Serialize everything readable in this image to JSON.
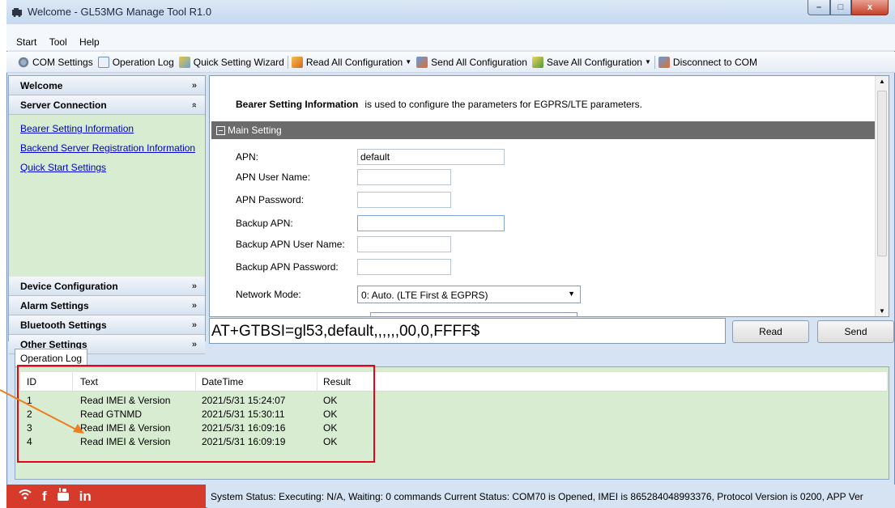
{
  "window": {
    "title": "Welcome - GL53MG Manage Tool R1.0",
    "controls": [
      "minimize",
      "maximize",
      "close"
    ]
  },
  "menu": [
    "Start",
    "Tool",
    "Help"
  ],
  "toolbar": {
    "com_settings": "COM Settings",
    "operation_log": "Operation Log",
    "quick_setting_wizard": "Quick Setting Wizard",
    "read_all": "Read All Configuration",
    "send_all": "Send All Configuration",
    "save_all": "Save All Configuration",
    "disconnect": "Disconnect to COM"
  },
  "nav": {
    "welcome": "Welcome",
    "server_connection": "Server Connection",
    "links": [
      "Bearer Setting Information",
      "Backend Server Registration Information",
      "Quick Start Settings"
    ],
    "device_configuration": "Device Configuration",
    "alarm_settings": "Alarm Settings",
    "bluetooth_settings": "Bluetooth Settings",
    "other_settings": "Other Settings"
  },
  "main": {
    "desc_title": "Bearer Setting Information",
    "desc_text": "is used to configure the parameters for EGPRS/LTE parameters.",
    "section": "Main Setting",
    "fields": {
      "apn_label": "APN:",
      "apn_value": "default",
      "apn_user_label": "APN User Name:",
      "apn_user_value": "",
      "apn_pass_label": "APN Password:",
      "apn_pass_value": "",
      "backup_apn_label": "Backup APN:",
      "backup_apn_value": "",
      "backup_user_label": "Backup APN User Name:",
      "backup_user_value": "",
      "backup_pass_label": "Backup APN Password:",
      "backup_pass_value": "",
      "network_mode_label": "Network Mode:",
      "network_mode_value": "0: Auto. (LTE First & EGPRS)"
    }
  },
  "command": {
    "text": "AT+GTBSI=gl53,default,,,,,,00,0,FFFF$",
    "read": "Read",
    "send": "Send"
  },
  "log": {
    "tab": "Operation Log",
    "headers": [
      "ID",
      "Text",
      "DateTime",
      "Result"
    ],
    "rows": [
      {
        "id": "1",
        "text": "Read IMEI & Version",
        "datetime": "2021/5/31 15:24:07",
        "result": "OK"
      },
      {
        "id": "2",
        "text": "Read GTNMD",
        "datetime": "2021/5/31 15:30:11",
        "result": "OK"
      },
      {
        "id": "3",
        "text": "Read IMEI & Version",
        "datetime": "2021/5/31 16:09:16",
        "result": "OK"
      },
      {
        "id": "4",
        "text": "Read IMEI & Version",
        "datetime": "2021/5/31 16:09:19",
        "result": "OK"
      }
    ]
  },
  "status": {
    "text": "System Status:  Executing: N/A, Waiting: 0 commands    Current Status:  COM70 is Opened, IMEI is 865284048993376, Protocol Version is 0200, APP Ver"
  },
  "social_icons": [
    "wifi-icon",
    "facebook-icon",
    "youtube-icon",
    "linkedin-icon"
  ],
  "colors": {
    "nav_bg": "#d7ecd0",
    "section_bar": "#6b6b6b",
    "highlight_box": "#e8001c",
    "arrow": "#f07c1c",
    "social_bar": "#d53a2a"
  }
}
